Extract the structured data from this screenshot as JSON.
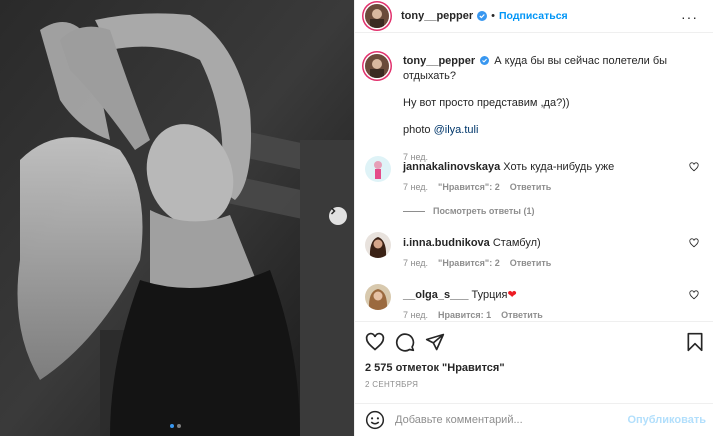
{
  "post": {
    "username": "tony__pepper",
    "separator": "•",
    "follow_label": "Подписаться",
    "more_label": "···"
  },
  "caption": {
    "username": "tony__pepper",
    "text": "А куда бы вы сейчас полетели бы отдыхать?",
    "line2": "Ну вот просто представим ,да?))",
    "photo_prefix": "photo ",
    "mention": "@ilya.tuli",
    "timestamp": "7 нед."
  },
  "comments": [
    {
      "username": "jannakalinovskaya",
      "text": "Хоть куда-нибудь уже",
      "time": "7 нед.",
      "likes": "\"Нравится\": 2",
      "reply": "Ответить",
      "view_replies": "Посмотреть ответы (1)"
    },
    {
      "username": "i.inna.budnikova",
      "text": "Стамбул)",
      "time": "7 нед.",
      "likes": "\"Нравится\": 2",
      "reply": "Ответить"
    },
    {
      "username": "__olga_s___",
      "text": "Турция",
      "emoji": "❤",
      "time": "7 нед.",
      "likes": "Нравится: 1",
      "reply": "Ответить"
    }
  ],
  "actions": {
    "icons": [
      "heart-icon",
      "comment-icon",
      "share-icon",
      "bookmark-icon"
    ]
  },
  "likes_text": "2 575 отметок \"Нравится\"",
  "date_text": "2 СЕНТЯБРЯ",
  "add_comment": {
    "placeholder": "Добавьте комментарий...",
    "publish_label": "Опубликовать"
  },
  "carousel": {
    "slide_count": 2,
    "active_index": 0
  },
  "colors": {
    "accent": "#0095f6",
    "publish_disabled": "#b2dffc",
    "story_ring": "#e1306c",
    "emoji_heart": "#ed1c24"
  }
}
